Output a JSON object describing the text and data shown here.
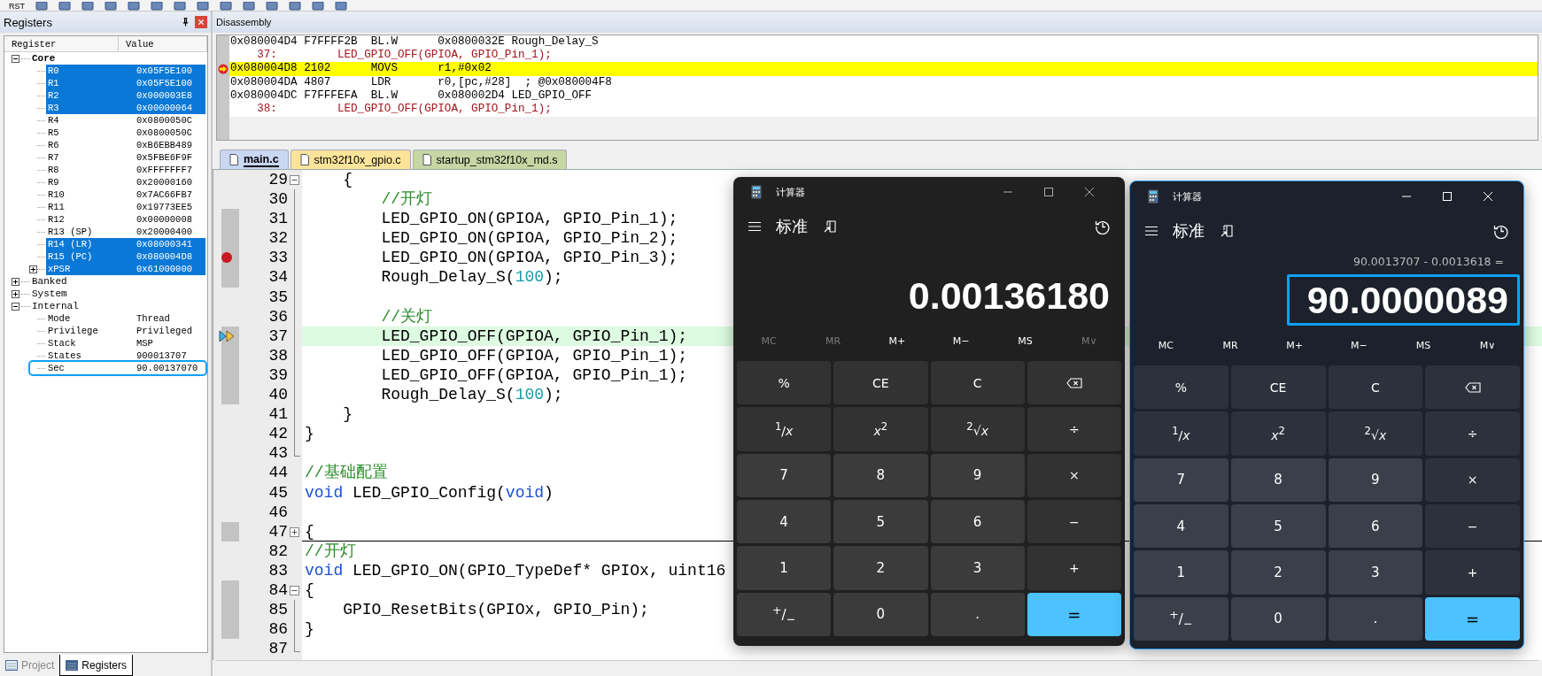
{
  "toolbar": {
    "reset_label": "RST"
  },
  "registers": {
    "title": "Registers",
    "columns": [
      "Register",
      "Value"
    ],
    "tree": [
      {
        "name": "Core",
        "expanded": true,
        "children": [
          {
            "name": "R0",
            "value": "0x05F5E100",
            "selected": true
          },
          {
            "name": "R1",
            "value": "0x05F5E100",
            "selected": true
          },
          {
            "name": "R2",
            "value": "0x000003E8",
            "selected": true
          },
          {
            "name": "R3",
            "value": "0x00000064",
            "selected": true
          },
          {
            "name": "R4",
            "value": "0x0800050C",
            "selected": false
          },
          {
            "name": "R5",
            "value": "0x0800050C",
            "selected": false
          },
          {
            "name": "R6",
            "value": "0xB6EBB489",
            "selected": false
          },
          {
            "name": "R7",
            "value": "0x5FBE6F9F",
            "selected": false
          },
          {
            "name": "R8",
            "value": "0xFFFFFFF7",
            "selected": false
          },
          {
            "name": "R9",
            "value": "0x20000160",
            "selected": false
          },
          {
            "name": "R10",
            "value": "0x7AC66FB7",
            "selected": false
          },
          {
            "name": "R11",
            "value": "0x19773EE5",
            "selected": false
          },
          {
            "name": "R12",
            "value": "0x00000008",
            "selected": false
          },
          {
            "name": "R13 (SP)",
            "value": "0x20000400",
            "selected": false
          },
          {
            "name": "R14 (LR)",
            "value": "0x08000341",
            "selected": true
          },
          {
            "name": "R15 (PC)",
            "value": "0x080004D8",
            "selected": true
          },
          {
            "name": "xPSR",
            "value": "0x61000000",
            "selected": true,
            "expanded": false
          }
        ]
      },
      {
        "name": "Banked",
        "expanded": false
      },
      {
        "name": "System",
        "expanded": false
      },
      {
        "name": "Internal",
        "expanded": true,
        "children": [
          {
            "name": "Mode",
            "value": "Thread",
            "selected": false
          },
          {
            "name": "Privilege",
            "value": "Privileged",
            "selected": false
          },
          {
            "name": "Stack",
            "value": "MSP",
            "selected": false
          },
          {
            "name": "States",
            "value": "900013707",
            "selected": false
          },
          {
            "name": "Sec",
            "value": "90.00137070",
            "selected": false,
            "outlined": true
          }
        ]
      }
    ],
    "tabs": [
      {
        "label": "Project",
        "selected": false
      },
      {
        "label": "Registers",
        "selected": true
      }
    ]
  },
  "disassembly": {
    "title": "Disassembly",
    "lines": [
      {
        "kind": "asm",
        "text": "0x080004D4 F7FFFF2B  BL.W      0x0800032E Rough_Delay_S",
        "current": false
      },
      {
        "kind": "source",
        "text": "    37:         LED_GPIO_OFF(GPIOA, GPIO_Pin_1);",
        "current": false
      },
      {
        "kind": "asm",
        "text": "0x080004D8 2102      MOVS      r1,#0x02",
        "current": true
      },
      {
        "kind": "asm",
        "text": "0x080004DA 4807      LDR       r0,[pc,#28]  ; @0x080004F8",
        "current": false
      },
      {
        "kind": "asm",
        "text": "0x080004DC F7FFFEFA  BL.W      0x080002D4 LED_GPIO_OFF",
        "current": false
      },
      {
        "kind": "source",
        "text": "    38:         LED_GPIO_OFF(GPIOA, GPIO_Pin_1);",
        "current": false
      }
    ]
  },
  "editor": {
    "tabs": [
      {
        "label": "main.c",
        "selected": true,
        "color": "#c9d7f2"
      },
      {
        "label": "stm32f10x_gpio.c",
        "selected": false,
        "color": "#fbe49a"
      },
      {
        "label": "startup_stm32f10x_md.s",
        "selected": false,
        "color": "#c6d6a4"
      }
    ],
    "lines": [
      {
        "number": "29",
        "kind": "open",
        "executable": false,
        "breakpoint": false,
        "current": false,
        "tokens": [
          {
            "kind": "plain",
            "text": "    {"
          }
        ]
      },
      {
        "number": "30",
        "kind": "inner",
        "executable": false,
        "breakpoint": false,
        "current": false,
        "tokens": [
          {
            "kind": "comment",
            "text": "        //开灯"
          }
        ]
      },
      {
        "number": "31",
        "kind": "inner",
        "executable": true,
        "breakpoint": false,
        "current": false,
        "tokens": [
          {
            "kind": "plain",
            "text": "        LED_GPIO_ON(GPIOA, GPIO_Pin_1);"
          }
        ]
      },
      {
        "number": "32",
        "kind": "inner",
        "executable": true,
        "breakpoint": false,
        "current": false,
        "tokens": [
          {
            "kind": "plain",
            "text": "        LED_GPIO_ON(GPIOA, GPIO_Pin_2);"
          }
        ]
      },
      {
        "number": "33",
        "kind": "inner",
        "executable": true,
        "breakpoint": true,
        "current": false,
        "tokens": [
          {
            "kind": "plain",
            "text": "        LED_GPIO_ON(GPIOA, GPIO_Pin_3);"
          }
        ]
      },
      {
        "number": "34",
        "kind": "inner",
        "executable": true,
        "breakpoint": false,
        "current": false,
        "tokens": [
          {
            "kind": "plain",
            "text": "        Rough_Delay_S("
          },
          {
            "kind": "number",
            "text": "100"
          },
          {
            "kind": "plain",
            "text": ");"
          }
        ]
      },
      {
        "number": "35",
        "kind": "inner",
        "executable": false,
        "breakpoint": false,
        "current": false
      },
      {
        "number": "36",
        "kind": "inner",
        "executable": false,
        "breakpoint": false,
        "current": false,
        "tokens": [
          {
            "kind": "comment",
            "text": "        //关灯"
          }
        ]
      },
      {
        "number": "37",
        "kind": "inner",
        "executable": true,
        "breakpoint": false,
        "current": true,
        "tokens": [
          {
            "kind": "plain",
            "text": "        LED_GPIO_OFF(GPIOA, GPIO_Pin_1);"
          }
        ]
      },
      {
        "number": "38",
        "kind": "inner",
        "executable": true,
        "breakpoint": false,
        "current": false,
        "tokens": [
          {
            "kind": "plain",
            "text": "        LED_GPIO_OFF(GPIOA, GPIO_Pin_1);"
          }
        ]
      },
      {
        "number": "39",
        "kind": "inner",
        "executable": true,
        "breakpoint": false,
        "current": false,
        "tokens": [
          {
            "kind": "plain",
            "text": "        LED_GPIO_OFF(GPIOA, GPIO_Pin_1);"
          }
        ]
      },
      {
        "number": "40",
        "kind": "inner",
        "executable": true,
        "breakpoint": false,
        "current": false,
        "tokens": [
          {
            "kind": "plain",
            "text": "        Rough_Delay_S("
          },
          {
            "kind": "number",
            "text": "100"
          },
          {
            "kind": "plain",
            "text": ");"
          }
        ]
      },
      {
        "number": "41",
        "kind": "inner",
        "executable": false,
        "breakpoint": false,
        "current": false,
        "tokens": [
          {
            "kind": "plain",
            "text": "    }"
          }
        ]
      },
      {
        "number": "42",
        "kind": "inner",
        "executable": false,
        "breakpoint": false,
        "current": false,
        "tokens": [
          {
            "kind": "plain",
            "text": "}"
          }
        ]
      },
      {
        "number": "43",
        "kind": "end",
        "executable": false,
        "breakpoint": false,
        "current": false
      },
      {
        "number": "44",
        "kind": "plain",
        "executable": false,
        "breakpoint": false,
        "current": false,
        "tokens": [
          {
            "kind": "comment",
            "text": "//基础配置"
          }
        ]
      },
      {
        "number": "45",
        "kind": "plain",
        "executable": false,
        "breakpoint": false,
        "current": false,
        "tokens": [
          {
            "kind": "keyword",
            "text": "void"
          },
          {
            "kind": "plain",
            "text": " LED_GPIO_Config("
          },
          {
            "kind": "keyword",
            "text": "void"
          },
          {
            "kind": "plain",
            "text": ")"
          }
        ]
      },
      {
        "number": "46",
        "kind": "plain",
        "executable": false,
        "breakpoint": false,
        "current": false
      },
      {
        "number": "47",
        "kind": "closed",
        "executable": true,
        "breakpoint": false,
        "current": false,
        "tokens": [
          {
            "kind": "plain",
            "text": "{"
          }
        ]
      },
      {
        "number": "82",
        "kind": "plain",
        "executable": false,
        "breakpoint": false,
        "current": false,
        "tokens": [
          {
            "kind": "comment",
            "text": "//开灯"
          }
        ]
      },
      {
        "number": "83",
        "kind": "plain",
        "executable": false,
        "breakpoint": false,
        "current": false,
        "tokens": [
          {
            "kind": "keyword",
            "text": "void"
          },
          {
            "kind": "plain",
            "text": " LED_GPIO_ON(GPIO_TypeDef* GPIOx, uint16"
          }
        ]
      },
      {
        "number": "84",
        "kind": "open",
        "executable": true,
        "breakpoint": false,
        "current": false,
        "tokens": [
          {
            "kind": "plain",
            "text": "{"
          }
        ]
      },
      {
        "number": "85",
        "kind": "inner",
        "executable": true,
        "breakpoint": false,
        "current": false,
        "tokens": [
          {
            "kind": "plain",
            "text": "    GPIO_ResetBits(GPIOx, GPIO_Pin);"
          }
        ]
      },
      {
        "number": "86",
        "kind": "inner",
        "executable": true,
        "breakpoint": false,
        "current": false,
        "tokens": [
          {
            "kind": "plain",
            "text": "}"
          }
        ]
      },
      {
        "number": "87",
        "kind": "end",
        "executable": false,
        "breakpoint": false,
        "current": false
      }
    ]
  },
  "calculators": [
    {
      "title": "计算器",
      "mode": "标准",
      "active": false,
      "display": "0.00136180",
      "outlined": false,
      "memory": [
        {
          "label": "MC",
          "disabled": true
        },
        {
          "label": "MR",
          "disabled": true
        },
        {
          "label": "M+",
          "disabled": false
        },
        {
          "label": "M−",
          "disabled": false
        },
        {
          "label": "MS",
          "disabled": false
        },
        {
          "label": "M∨",
          "disabled": true
        }
      ],
      "keys": [
        {
          "kind": "op",
          "label": "%"
        },
        {
          "kind": "op",
          "label": "CE"
        },
        {
          "kind": "op",
          "label": "C"
        },
        {
          "kind": "backspace"
        },
        {
          "kind": "op",
          "label": "$^{1}$/*x*"
        },
        {
          "kind": "op",
          "label": "*x*$^{2}$"
        },
        {
          "kind": "op",
          "label": "$^{2}$√*x*"
        },
        {
          "kind": "op",
          "label": "÷"
        },
        {
          "kind": "digit",
          "label": "7"
        },
        {
          "kind": "digit",
          "label": "8"
        },
        {
          "kind": "digit",
          "label": "9"
        },
        {
          "kind": "op",
          "label": "×"
        },
        {
          "kind": "digit",
          "label": "4"
        },
        {
          "kind": "digit",
          "label": "5"
        },
        {
          "kind": "digit",
          "label": "6"
        },
        {
          "kind": "op",
          "label": "−"
        },
        {
          "kind": "digit",
          "label": "1"
        },
        {
          "kind": "digit",
          "label": "2"
        },
        {
          "kind": "digit",
          "label": "3"
        },
        {
          "kind": "op",
          "label": "+"
        },
        {
          "kind": "digit",
          "label": "$^{+}$/$_{−}$"
        },
        {
          "kind": "digit",
          "label": "0"
        },
        {
          "kind": "digit",
          "label": "."
        },
        {
          "kind": "equals",
          "label": "="
        }
      ]
    },
    {
      "title": "计算器",
      "mode": "标准",
      "active": true,
      "expression": "90.0013707 - 0.0013618 =",
      "display": "90.0000089",
      "outlined": true,
      "memory": [
        {
          "label": "MC",
          "disabled": false
        },
        {
          "label": "MR",
          "disabled": false
        },
        {
          "label": "M+",
          "disabled": false
        },
        {
          "label": "M−",
          "disabled": false
        },
        {
          "label": "MS",
          "disabled": false
        },
        {
          "label": "M∨",
          "disabled": false
        }
      ],
      "keys": [
        {
          "kind": "op",
          "label": "%"
        },
        {
          "kind": "op",
          "label": "CE"
        },
        {
          "kind": "op",
          "label": "C"
        },
        {
          "kind": "backspace"
        },
        {
          "kind": "op",
          "label": "$^{1}$/*x*"
        },
        {
          "kind": "op",
          "label": "*x*$^{2}$"
        },
        {
          "kind": "op",
          "label": "$^{2}$√*x*"
        },
        {
          "kind": "op",
          "label": "÷"
        },
        {
          "kind": "digit",
          "label": "7"
        },
        {
          "kind": "digit",
          "label": "8"
        },
        {
          "kind": "digit",
          "label": "9"
        },
        {
          "kind": "op",
          "label": "×"
        },
        {
          "kind": "digit",
          "label": "4"
        },
        {
          "kind": "digit",
          "label": "5"
        },
        {
          "kind": "digit",
          "label": "6"
        },
        {
          "kind": "op",
          "label": "−"
        },
        {
          "kind": "digit",
          "label": "1"
        },
        {
          "kind": "digit",
          "label": "2"
        },
        {
          "kind": "digit",
          "label": "3"
        },
        {
          "kind": "op",
          "label": "+"
        },
        {
          "kind": "digit",
          "label": "$^{+}$/$_{−}$"
        },
        {
          "kind": "digit",
          "label": "0"
        },
        {
          "kind": "digit",
          "label": "."
        },
        {
          "kind": "equals",
          "label": "="
        }
      ]
    }
  ]
}
